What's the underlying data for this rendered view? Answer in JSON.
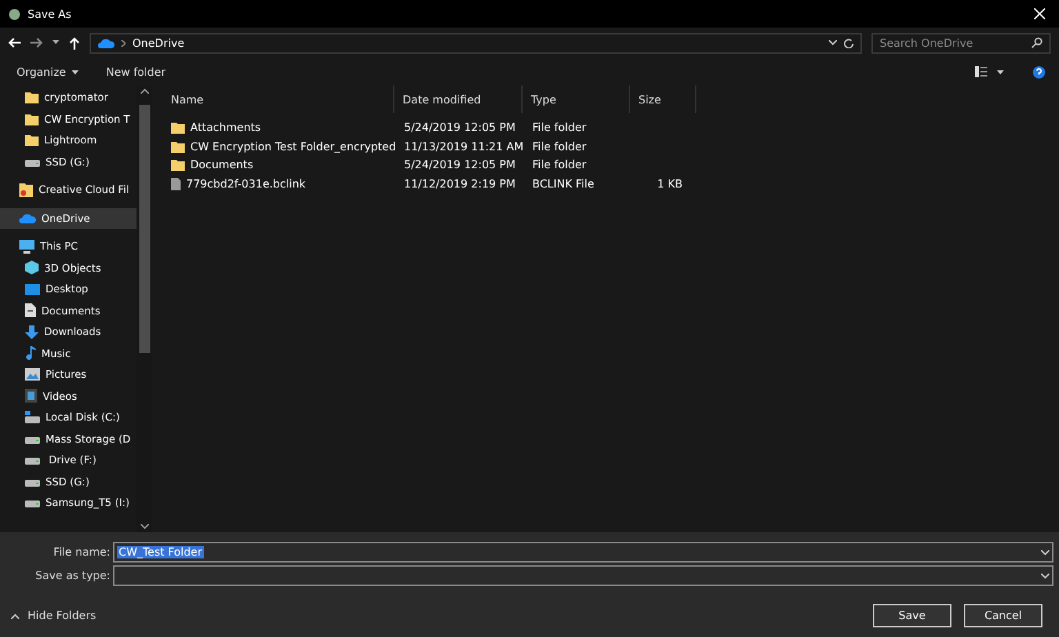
{
  "window": {
    "title": "Save As"
  },
  "address_bar": {
    "location": "OneDrive"
  },
  "search": {
    "placeholder": "Search OneDrive"
  },
  "toolbar": {
    "organize": "Organize",
    "new_folder": "New folder"
  },
  "sidebar": {
    "nested_items": [
      {
        "label": "cryptomator",
        "kind": "folder",
        "selected": false
      },
      {
        "label": "CW Encryption T",
        "kind": "folder",
        "selected": false
      },
      {
        "label": "Lightroom",
        "kind": "folder",
        "selected": false
      },
      {
        "label": "SSD (G:)",
        "kind": "drive",
        "selected": false
      }
    ],
    "items": [
      {
        "label": "Creative Cloud Fil",
        "kind": "cloudfolder",
        "selected": false
      },
      {
        "label": "OneDrive",
        "kind": "cloud",
        "selected": true
      },
      {
        "label": "This PC",
        "kind": "pc",
        "selected": false,
        "children": [
          {
            "label": "3D Objects",
            "kind": "cube",
            "selected": false
          },
          {
            "label": "Desktop",
            "kind": "desktop",
            "selected": false
          },
          {
            "label": "Documents",
            "kind": "doc",
            "selected": false
          },
          {
            "label": "Downloads",
            "kind": "download",
            "selected": false
          },
          {
            "label": "Music",
            "kind": "music",
            "selected": false
          },
          {
            "label": "Pictures",
            "kind": "picture",
            "selected": false
          },
          {
            "label": "Videos",
            "kind": "video",
            "selected": false
          },
          {
            "label": "Local Disk (C:)",
            "kind": "sysdrive",
            "selected": false
          },
          {
            "label": "Mass Storage (D",
            "kind": "drive",
            "selected": false
          },
          {
            "label": " Drive (F:)",
            "kind": "drive",
            "selected": false
          },
          {
            "label": "SSD (G:)",
            "kind": "drive",
            "selected": false
          },
          {
            "label": "Samsung_T5 (I:)",
            "kind": "drive",
            "selected": false
          }
        ]
      }
    ]
  },
  "table": {
    "columns": [
      "Name",
      "Date modified",
      "Type",
      "Size"
    ],
    "rows": [
      {
        "kind": "folder",
        "name": "Attachments",
        "date": "5/24/2019 12:05 PM",
        "type": "File folder",
        "size": ""
      },
      {
        "kind": "folder",
        "name": "CW Encryption Test Folder_encrypted",
        "date": "11/13/2019 11:21 AM",
        "type": "File folder",
        "size": ""
      },
      {
        "kind": "folder",
        "name": "Documents",
        "date": "5/24/2019 12:05 PM",
        "type": "File folder",
        "size": ""
      },
      {
        "kind": "file",
        "name": "779cbd2f-031e.bclink",
        "date": "11/12/2019 2:19 PM",
        "type": "BCLINK File",
        "size": "1 KB"
      }
    ]
  },
  "form": {
    "file_name_label": "File name:",
    "file_name": "CW_Test Folder",
    "type_label": "Save as type:"
  },
  "hide_folders": "Hide Folders",
  "buttons": [
    "Save",
    "Cancel"
  ]
}
